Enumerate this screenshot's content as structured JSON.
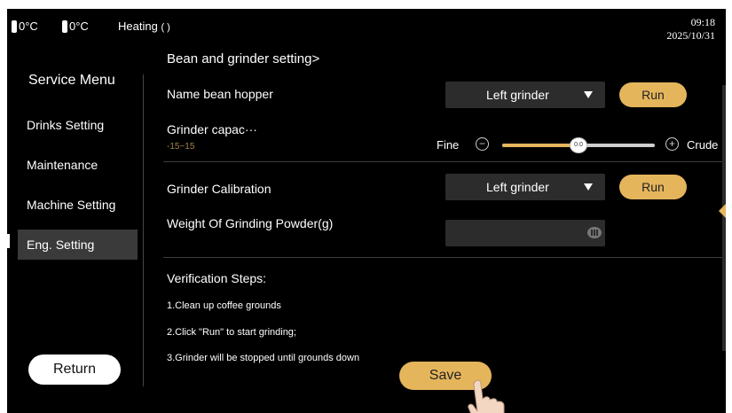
{
  "status": {
    "temp1": "0°C",
    "temp2": "0°C",
    "heating_label": "Heating",
    "time": "09:18",
    "date": "2025/10/31"
  },
  "sidebar": {
    "title": "Service Menu",
    "items": [
      {
        "label": "Drinks Setting",
        "active": false
      },
      {
        "label": "Maintenance",
        "active": false
      },
      {
        "label": "Machine Setting",
        "active": false
      },
      {
        "label": "Eng. Setting",
        "active": true
      }
    ],
    "return_label": "Return"
  },
  "main": {
    "section_title": "Bean and grinder setting>",
    "bean_hopper": {
      "label": "Name bean hopper",
      "selected": "Left grinder",
      "run_label": "Run"
    },
    "grinder_capacity": {
      "label": "Grinder capac···",
      "range": "-15~15",
      "min_label": "Fine",
      "max_label": "Crude",
      "value": "0.0",
      "min": -15,
      "max": 15,
      "current": 0
    },
    "grinder_calibration": {
      "label": "Grinder Calibration",
      "selected": "Left grinder",
      "run_label": "Run"
    },
    "weight": {
      "label": "Weight Of Grinding Powder(g)",
      "value": ""
    },
    "verification": {
      "title": "Verification Steps:",
      "steps": [
        "1.Clean up coffee grounds",
        "2.Click \"Run\" to start grinding;",
        "3.Grinder will be stopped until grounds down"
      ]
    },
    "save_label": "Save"
  },
  "colors": {
    "accent": "#e5b55c",
    "background": "#000000",
    "control_bg": "#2c2c2c",
    "range_hint": "#a08548"
  },
  "icons": {
    "thermometer": "thermometer-icon",
    "heating": "heating-spinner-icon",
    "dropdown": "chevron-down-icon",
    "minus": "minus-circle-icon",
    "plus": "plus-circle-icon",
    "keyboard": "keyboard-icon",
    "pointer": "hand-pointer-icon"
  }
}
